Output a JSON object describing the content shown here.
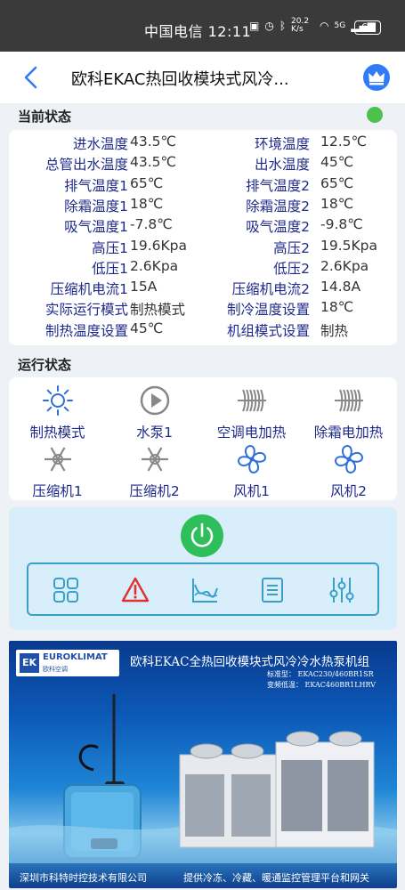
{
  "status_bar": {
    "carrier_time": "中国电信 12:11",
    "net_speed": "20.2 K/s",
    "signal": "5G",
    "battery": "60"
  },
  "header": {
    "title": "欧科EKAC热回收模块式风冷..."
  },
  "current_status": {
    "section_title": "当前状态",
    "rows": [
      {
        "l_label": "进水温度",
        "l_value": "43.5℃",
        "r_label": "环境温度",
        "r_value": "12.5℃"
      },
      {
        "l_label": "总管出水温度",
        "l_value": "43.5℃",
        "r_label": "出水温度",
        "r_value": "45℃"
      },
      {
        "l_label": "排气温度1",
        "l_value": "65℃",
        "r_label": "排气温度2",
        "r_value": "65℃"
      },
      {
        "l_label": "除霜温度1",
        "l_value": "18℃",
        "r_label": "除霜温度2",
        "r_value": "18℃"
      },
      {
        "l_label": "吸气温度1",
        "l_value": "-7.8℃",
        "r_label": "吸气温度2",
        "r_value": "-9.8℃"
      },
      {
        "l_label": "高压1",
        "l_value": "19.6Kpa",
        "r_label": "高压2",
        "r_value": "19.5Kpa"
      },
      {
        "l_label": "低压1",
        "l_value": "2.6Kpa",
        "r_label": "低压2",
        "r_value": "2.6Kpa"
      },
      {
        "l_label": "压缩机电流1",
        "l_value": "15A",
        "r_label": "压缩机电流2",
        "r_value": "14.8A"
      },
      {
        "l_label": "实际运行模式",
        "l_value": "制热模式",
        "r_label": "制冷温度设置",
        "r_value": "18℃"
      },
      {
        "l_label": "制热温度设置",
        "l_value": "45℃",
        "r_label": "机组模式设置",
        "r_value": "制热"
      }
    ]
  },
  "run_status": {
    "section_title": "运行状态",
    "items": [
      {
        "label": "制热模式",
        "icon": "sun-icon"
      },
      {
        "label": "水泵1",
        "icon": "pump-play-icon"
      },
      {
        "label": "空调电加热",
        "icon": "heater-icon"
      },
      {
        "label": "除霜电加热",
        "icon": "heater-icon"
      },
      {
        "label": "压缩机1",
        "icon": "snowflake-icon"
      },
      {
        "label": "压缩机2",
        "icon": "snowflake-icon"
      },
      {
        "label": "风机1",
        "icon": "fan-icon"
      },
      {
        "label": "风机2",
        "icon": "fan-icon"
      }
    ]
  },
  "banner": {
    "logo_badge": "EK",
    "logo_brand": "EUROKLIMAT",
    "logo_brand_cn": "欧科空调",
    "title": "欧科EKAC全热回收模块式风冷冷水热泵机组",
    "spec_standard": "标准型： EKAC230/460BR1SR",
    "spec_variable": "变频低温： EKAC460BR1LHRV",
    "footer_company": "深圳市科特时控技术有限公司",
    "footer_service": "提供冷冻、冷藏、暖通监控管理平台和网关"
  },
  "colors": {
    "label_blue": "#1f2a8a",
    "online_green": "#4cc24c",
    "power_green": "#2fbf5a",
    "active_blue": "#2f6fd8",
    "inactive_gray": "#888888",
    "alarm_red": "#e03030"
  }
}
